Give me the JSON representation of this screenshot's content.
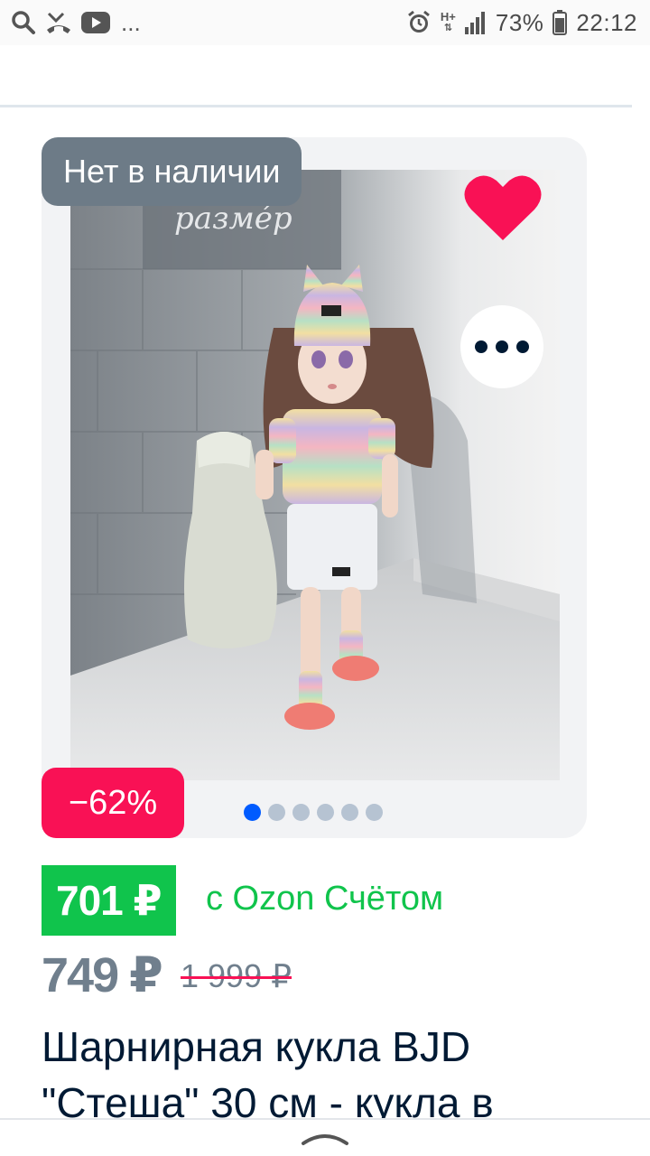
{
  "status_bar": {
    "notification_icons": [
      "search-icon",
      "missed-call-icon",
      "youtube-icon"
    ],
    "overflow": "...",
    "network": "H+",
    "battery": "73%",
    "time": "22:12"
  },
  "product": {
    "stock_label": "Нет в наличии",
    "discount": "−62%",
    "gallery": {
      "total_images": 6,
      "active_index": 0
    },
    "price_card": "701 ₽",
    "price_card_note": "с Ozon Счётом",
    "price": "749 ₽",
    "old_price": "1 999 ₽",
    "title": "Шарнирная кукла BJD \"Стеша\" 30 см - кукла в",
    "image_caption": "разме́р"
  },
  "colors": {
    "accent_blue": "#005bff",
    "discount_pink": "#f91155",
    "ozon_green": "#10c44c",
    "badge_gray": "#6d7b87",
    "favorite_red": "#f91155"
  }
}
